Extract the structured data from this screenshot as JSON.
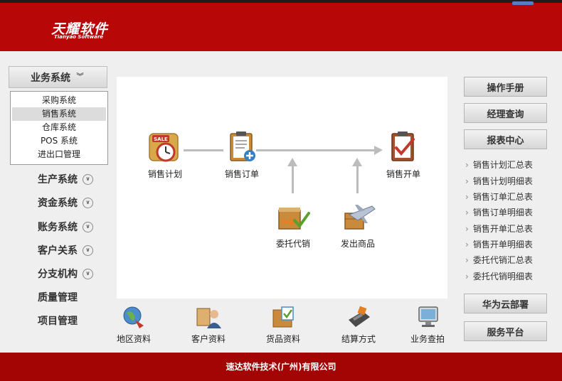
{
  "header": {
    "logo_main": "天耀软件",
    "logo_sub": "Tianyao Software"
  },
  "left_nav": {
    "head": {
      "label": "业务系统",
      "icon": "chevron-down-icon"
    },
    "sub_items": [
      {
        "label": "采购系统"
      },
      {
        "label": "销售系统",
        "active": true
      },
      {
        "label": "仓库系统"
      },
      {
        "label": "POS 系统"
      },
      {
        "label": "进出口管理"
      }
    ],
    "items": [
      {
        "label": "生产系统",
        "has_chevron": true
      },
      {
        "label": "资金系统",
        "has_chevron": true
      },
      {
        "label": "账务系统",
        "has_chevron": true
      },
      {
        "label": "客户关系",
        "has_chevron": true
      },
      {
        "label": "分支机构",
        "has_chevron": true
      },
      {
        "label": "质量管理",
        "has_chevron": false
      },
      {
        "label": "项目管理",
        "has_chevron": false
      }
    ]
  },
  "flow": {
    "nodes": [
      {
        "label": "销售计划",
        "icon": "sale-clock-icon"
      },
      {
        "label": "销售订单",
        "icon": "clipboard-add-icon"
      },
      {
        "label": "销售开单",
        "icon": "clipboard-check-icon"
      },
      {
        "label": "委托代销",
        "icon": "consign-box-icon"
      },
      {
        "label": "发出商品",
        "icon": "airplane-cargo-icon"
      }
    ]
  },
  "right_panel": {
    "manual_label": "操作手册",
    "manager_label": "经理查询",
    "report_center_label": "报表中心",
    "reports": [
      "销售计划汇总表",
      "销售计划明细表",
      "销售订单汇总表",
      "销售订单明细表",
      "销售开单汇总表",
      "销售开单明细表",
      "委托代销汇总表",
      "委托代销明细表"
    ],
    "huawei_label": "华为云部署",
    "service_label": "服务平台"
  },
  "bottom_bar": [
    {
      "label": "地区资料",
      "icon": "region-icon"
    },
    {
      "label": "客户资料",
      "icon": "customer-icon"
    },
    {
      "label": "货品资料",
      "icon": "goods-icon"
    },
    {
      "label": "结算方式",
      "icon": "settlement-icon"
    },
    {
      "label": "业务查拍",
      "icon": "query-icon"
    }
  ],
  "footer": {
    "company": "速达软件技术(广州)有限公司"
  },
  "colors": {
    "brand_red": "#b80707",
    "footer_red": "#a30505",
    "panel_gray": "#efefef"
  }
}
